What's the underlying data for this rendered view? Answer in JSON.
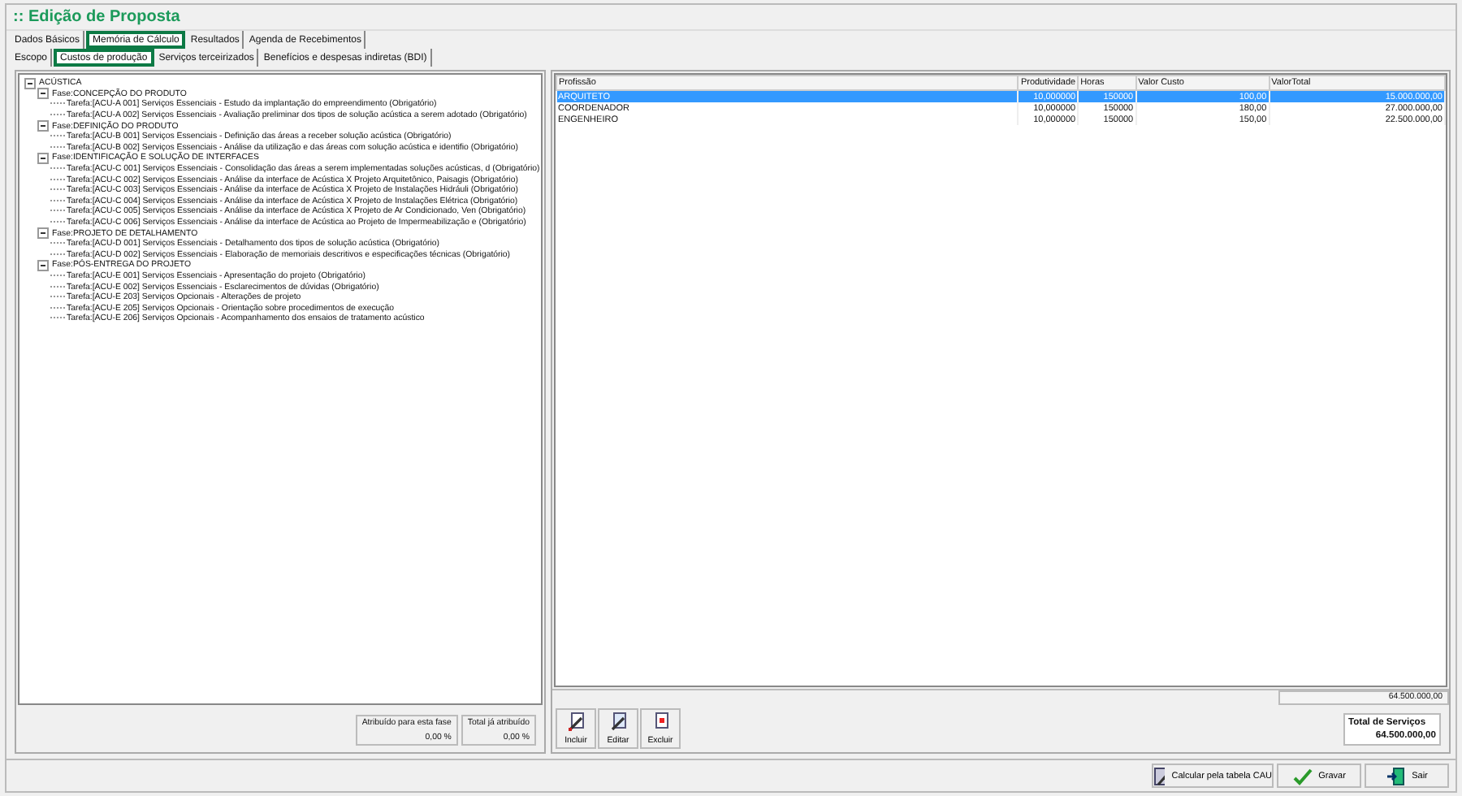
{
  "window": {
    "title": ":: Edição de Proposta"
  },
  "tabs": [
    {
      "label": "Dados Básicos",
      "selected": false
    },
    {
      "label": "Memória de Cálculo",
      "selected": true
    },
    {
      "label": "Resultados",
      "selected": false
    },
    {
      "label": "Agenda de Recebimentos",
      "selected": false
    }
  ],
  "subtabs": [
    {
      "label": "Escopo",
      "selected": false
    },
    {
      "label": "Custos de produção",
      "selected": true
    },
    {
      "label": "Serviços terceirizados",
      "selected": false
    },
    {
      "label": "Benefícios e despesas indiretas (BDI)",
      "selected": false
    }
  ],
  "tree": [
    {
      "label": "ACÚSTICA",
      "expanded": true,
      "children": [
        {
          "label": "Fase:CONCEPÇÃO DO PRODUTO",
          "expanded": true,
          "children": [
            {
              "label": "Tarefa:[ACU-A 001] Serviços Essenciais - Estudo da implantação do empreendimento (Obrigatório)"
            },
            {
              "label": "Tarefa:[ACU-A 002] Serviços Essenciais - Avaliação preliminar dos tipos de solução acústica a serem adotado (Obrigatório)"
            }
          ]
        },
        {
          "label": "Fase:DEFINIÇÃO DO PRODUTO",
          "expanded": true,
          "children": [
            {
              "label": "Tarefa:[ACU-B 001] Serviços Essenciais - Definição das áreas a receber solução acústica (Obrigatório)"
            },
            {
              "label": "Tarefa:[ACU-B 002] Serviços Essenciais - Análise da utilização e das áreas com solução acústica e identifio (Obrigatório)"
            }
          ]
        },
        {
          "label": "Fase:IDENTIFICAÇÃO E SOLUÇÃO DE INTERFACES",
          "expanded": true,
          "children": [
            {
              "label": "Tarefa:[ACU-C 001] Serviços Essenciais - Consolidação das áreas a serem implementadas soluções acústicas, d (Obrigatório)"
            },
            {
              "label": "Tarefa:[ACU-C 002] Serviços Essenciais - Análise da interface de Acústica X Projeto Arquitetônico, Paisagis (Obrigatório)"
            },
            {
              "label": "Tarefa:[ACU-C 003] Serviços Essenciais - Análise da interface de Acústica X Projeto de Instalações Hidráuli (Obrigatório)"
            },
            {
              "label": "Tarefa:[ACU-C 004] Serviços Essenciais - Análise da interface de Acústica X Projeto de Instalações Elétrica (Obrigatório)"
            },
            {
              "label": "Tarefa:[ACU-C 005] Serviços Essenciais - Análise da interface de Acústica X Projeto de Ar Condicionado, Ven (Obrigatório)"
            },
            {
              "label": "Tarefa:[ACU-C 006] Serviços Essenciais - Análise da interface de Acústica ao Projeto de Impermeabilização e (Obrigatório)"
            }
          ]
        },
        {
          "label": "Fase:PROJETO DE DETALHAMENTO",
          "expanded": true,
          "children": [
            {
              "label": "Tarefa:[ACU-D 001] Serviços Essenciais - Detalhamento dos tipos de solução acústica (Obrigatório)"
            },
            {
              "label": "Tarefa:[ACU-D 002] Serviços Essenciais - Elaboração de memoriais descritivos e especificações técnicas (Obrigatório)"
            }
          ]
        },
        {
          "label": "Fase:PÓS-ENTREGA DO PROJETO",
          "expanded": true,
          "children": [
            {
              "label": "Tarefa:[ACU-E 001] Serviços Essenciais - Apresentação do projeto (Obrigatório)"
            },
            {
              "label": "Tarefa:[ACU-E 002] Serviços Essenciais - Esclarecimentos de dúvidas (Obrigatório)"
            },
            {
              "label": "Tarefa:[ACU-E 203] Serviços Opcionais - Alterações de projeto"
            },
            {
              "label": "Tarefa:[ACU-E 205] Serviços Opcionais - Orientação sobre procedimentos de execução"
            },
            {
              "label": "Tarefa:[ACU-E 206] Serviços Opcionais - Acompanhamento dos ensaios de tratamento acústico"
            }
          ]
        }
      ]
    }
  ],
  "phase_summary": [
    {
      "label": "Atribuído para esta fase",
      "value": "0,00 %"
    },
    {
      "label": "Total já atribuído",
      "value": "0,00 %"
    }
  ],
  "table": {
    "columns": [
      "Profissão",
      "Produtividade",
      "Horas",
      "Valor Custo",
      "ValorTotal"
    ],
    "rows": [
      {
        "cells": [
          "ARQUITETO",
          "10,000000",
          "150000",
          "100,00",
          "15.000.000,00"
        ],
        "selected": true
      },
      {
        "cells": [
          "COORDENADOR",
          "10,000000",
          "150000",
          "180,00",
          "27.000.000,00"
        ],
        "selected": false
      },
      {
        "cells": [
          "ENGENHEIRO",
          "10,000000",
          "150000",
          "150,00",
          "22.500.000,00"
        ],
        "selected": false
      }
    ],
    "footer_total": "64.500.000,00"
  },
  "table_buttons": [
    "Incluir",
    "Editar",
    "Excluir"
  ],
  "services_total": {
    "label": "Total de Serviços",
    "value": "64.500.000,00"
  },
  "footer_buttons": [
    {
      "label": "Calcular pela tabela CAU",
      "kind": "calc"
    },
    {
      "label": "Gravar",
      "kind": "save"
    },
    {
      "label": "Sair",
      "kind": "exit"
    }
  ]
}
